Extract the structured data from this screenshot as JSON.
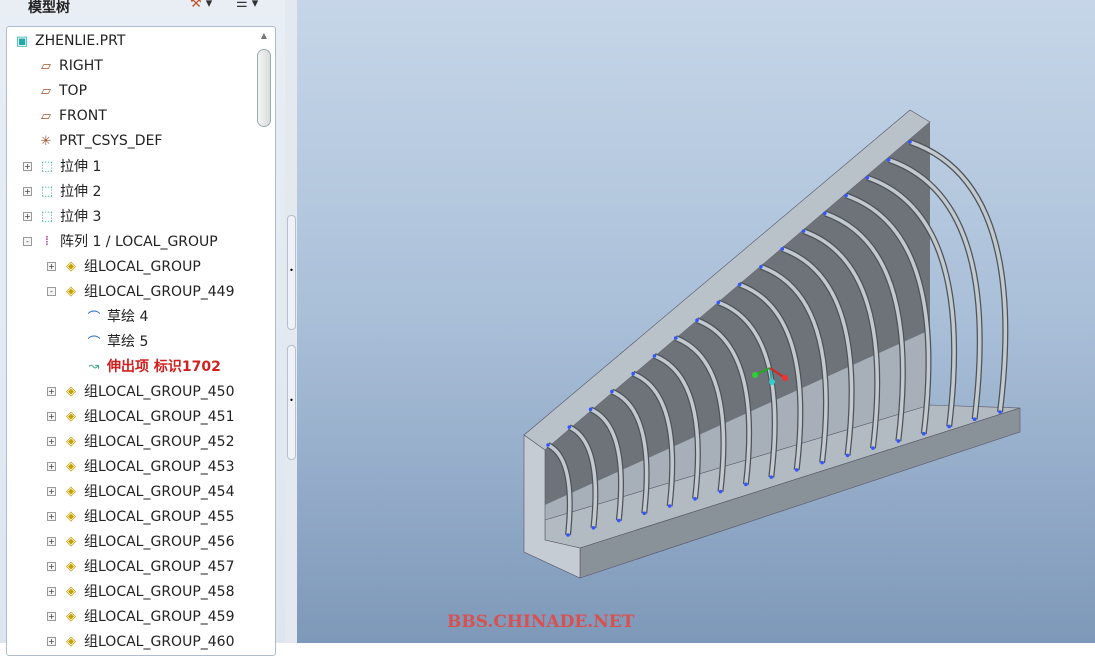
{
  "panel": {
    "title": "模型树",
    "settings_icon": "tree-settings-icon",
    "columns_icon": "tree-columns-icon"
  },
  "tree": [
    {
      "label": "ZHENLIE.PRT",
      "level": 0,
      "icon": "part-icon",
      "exp": ""
    },
    {
      "label": "RIGHT",
      "level": 1,
      "icon": "datum-plane-icon",
      "exp": ""
    },
    {
      "label": "TOP",
      "level": 1,
      "icon": "datum-plane-icon",
      "exp": ""
    },
    {
      "label": "FRONT",
      "level": 1,
      "icon": "datum-plane-icon",
      "exp": ""
    },
    {
      "label": "PRT_CSYS_DEF",
      "level": 1,
      "icon": "csys-icon",
      "exp": ""
    },
    {
      "label": "拉伸 1",
      "level": 1,
      "icon": "extrude-icon",
      "exp": "+"
    },
    {
      "label": "拉伸 2",
      "level": 1,
      "icon": "extrude-icon",
      "exp": "+"
    },
    {
      "label": "拉伸 3",
      "level": 1,
      "icon": "extrude-icon",
      "exp": "+"
    },
    {
      "label": "阵列 1 / LOCAL_GROUP",
      "level": 1,
      "icon": "pattern-icon",
      "exp": "-"
    },
    {
      "label": "组LOCAL_GROUP",
      "level": 2,
      "icon": "group-icon",
      "exp": "+"
    },
    {
      "label": "组LOCAL_GROUP_449",
      "level": 2,
      "icon": "group-icon",
      "exp": "-"
    },
    {
      "label": "草绘 4",
      "level": 3,
      "icon": "sketch-icon",
      "exp": ""
    },
    {
      "label": "草绘 5",
      "level": 3,
      "icon": "sketch-icon",
      "exp": ""
    },
    {
      "label": "伸出项 标识1702",
      "level": 3,
      "icon": "protrusion-icon",
      "exp": "",
      "error": true
    },
    {
      "label": "组LOCAL_GROUP_450",
      "level": 2,
      "icon": "group-icon",
      "exp": "+"
    },
    {
      "label": "组LOCAL_GROUP_451",
      "level": 2,
      "icon": "group-icon",
      "exp": "+"
    },
    {
      "label": "组LOCAL_GROUP_452",
      "level": 2,
      "icon": "group-icon",
      "exp": "+"
    },
    {
      "label": "组LOCAL_GROUP_453",
      "level": 2,
      "icon": "group-icon",
      "exp": "+"
    },
    {
      "label": "组LOCAL_GROUP_454",
      "level": 2,
      "icon": "group-icon",
      "exp": "+"
    },
    {
      "label": "组LOCAL_GROUP_455",
      "level": 2,
      "icon": "group-icon",
      "exp": "+"
    },
    {
      "label": "组LOCAL_GROUP_456",
      "level": 2,
      "icon": "group-icon",
      "exp": "+"
    },
    {
      "label": "组LOCAL_GROUP_457",
      "level": 2,
      "icon": "group-icon",
      "exp": "+"
    },
    {
      "label": "组LOCAL_GROUP_458",
      "level": 2,
      "icon": "group-icon",
      "exp": "+"
    },
    {
      "label": "组LOCAL_GROUP_459",
      "level": 2,
      "icon": "group-icon",
      "exp": "+"
    },
    {
      "label": "组LOCAL_GROUP_460",
      "level": 2,
      "icon": "group-icon",
      "exp": "+"
    }
  ],
  "watermark": "BBS.CHINADE.NET"
}
